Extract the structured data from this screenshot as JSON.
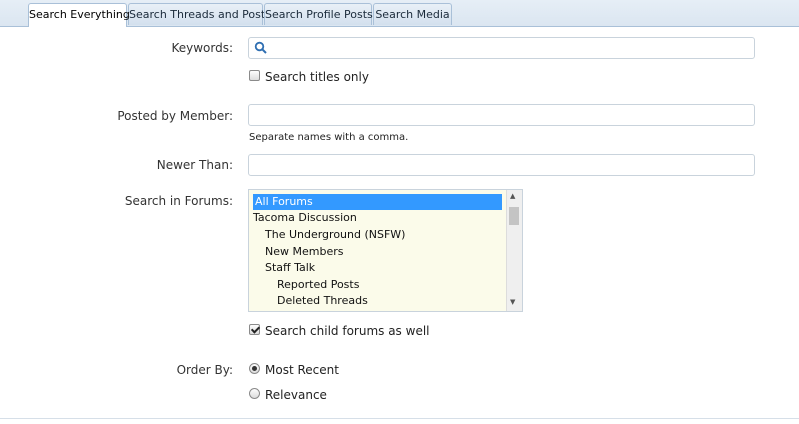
{
  "tabs": [
    {
      "label": "Search Everything",
      "active": true
    },
    {
      "label": "Search Threads and Posts"
    },
    {
      "label": "Search Profile Posts"
    },
    {
      "label": "Search Media"
    }
  ],
  "form": {
    "keywords_label": "Keywords:",
    "keywords_value": "",
    "titles_only_label": "Search titles only",
    "posted_by_label": "Posted by Member:",
    "posted_by_hint": "Separate names with a comma.",
    "newer_than_label": "Newer Than:",
    "forums_label": "Search in Forums:",
    "forums": [
      "All Forums",
      "Tacoma Discussion",
      "The Underground (NSFW)",
      "New Members",
      "Staff Talk",
      "Reported Posts",
      "Deleted Threads"
    ],
    "child_forums_label": "Search child forums as well",
    "order_by_label": "Order By:",
    "order_most_recent": "Most Recent",
    "order_relevance": "Relevance"
  },
  "colors": {
    "selected_bg": "#3399ff",
    "list_bg": "#fbfbea"
  }
}
